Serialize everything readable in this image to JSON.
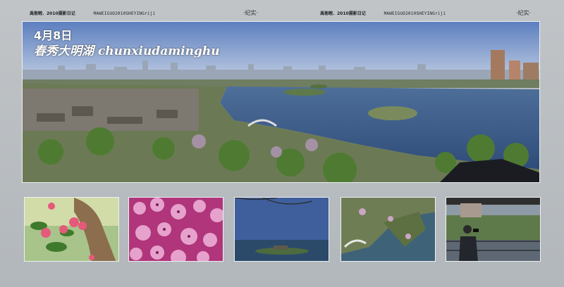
{
  "header": {
    "left_title": "禹衙暇．2010摄影日记",
    "left_code": "MAWEIGUO2010SHEYINGriji",
    "left_mark": "·纪实·",
    "right_title": "禹衙暇．2010摄影日记",
    "right_code": "MAWEIGUO2010SHEYINGriji",
    "right_mark": "·纪实·"
  },
  "panorama": {
    "date": "4月8日",
    "title": "春秀大明湖  chunxiudaminghu"
  }
}
